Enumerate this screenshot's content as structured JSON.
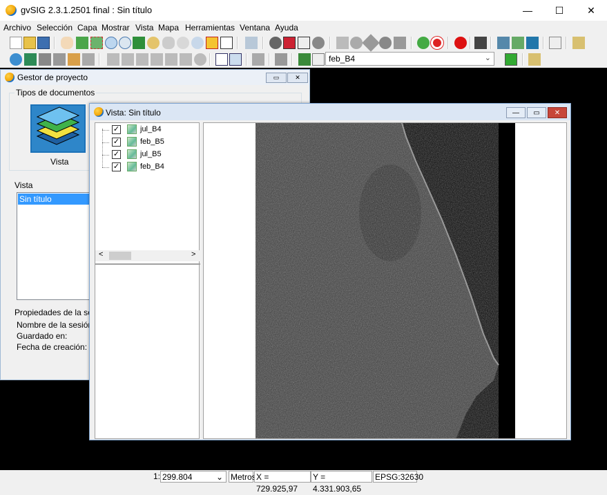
{
  "window": {
    "title": "gvSIG 2.3.1.2501 final : Sin título",
    "minimize_label": "—",
    "maximize_label": "☐",
    "close_label": "✕"
  },
  "menu": [
    {
      "label": "Archivo"
    },
    {
      "label": "Selección"
    },
    {
      "label": "Capa"
    },
    {
      "label": "Mostrar"
    },
    {
      "label": "Vista"
    },
    {
      "label": "Mapa"
    },
    {
      "label": "Herramientas"
    },
    {
      "label": "Ventana"
    },
    {
      "label": "Ayuda"
    }
  ],
  "toolbar": {
    "active_layer": "feb_B4",
    "dropdown_arrow": "⌄"
  },
  "gestor": {
    "title": "Gestor de proyecto",
    "tipos_label": "Tipos de documentos",
    "vista_type_label": "Vista",
    "vista_group_label": "Vista",
    "views": [
      "Sin título"
    ],
    "props_label": "Propiedades de la sesi",
    "session_name_label": "Nombre de la sesión:",
    "saved_in_label": "Guardado en:",
    "creation_date_label": "Fecha de creación:"
  },
  "vista": {
    "title": "Vista: Sin título",
    "layers": [
      {
        "name": "jul_B4",
        "checked": true
      },
      {
        "name": "feb_B5",
        "checked": true
      },
      {
        "name": "jul_B5",
        "checked": true
      },
      {
        "name": "feb_B4",
        "checked": true
      }
    ],
    "check_glyph": "✓",
    "scroll_left": "<",
    "scroll_right": ">"
  },
  "status": {
    "scale_prefix": "1:",
    "scale": "299.804",
    "scale_arrow": "⌄",
    "units": "Metros",
    "x": "X = 729.925,97",
    "y": "Y = 4.331.903,65",
    "epsg": "EPSG:32630"
  }
}
